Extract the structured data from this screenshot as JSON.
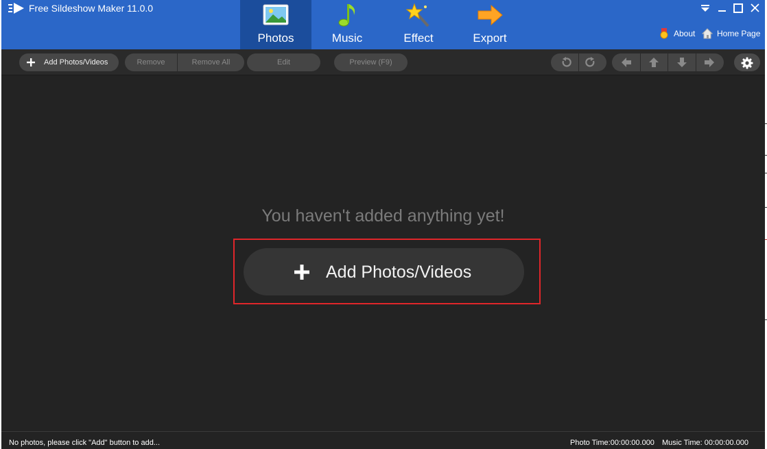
{
  "window": {
    "title": "Free Sildeshow Maker 11.0.0"
  },
  "tabs": [
    {
      "label": "Photos",
      "icon": "photo-icon",
      "active": true
    },
    {
      "label": "Music",
      "icon": "music-note-icon",
      "active": false
    },
    {
      "label": "Effect",
      "icon": "magic-wand-icon",
      "active": false
    },
    {
      "label": "Export",
      "icon": "arrow-right-icon",
      "active": false
    }
  ],
  "top_links": {
    "about": "About",
    "home": "Home Page"
  },
  "toolbar": {
    "add_label": "Add Photos/Videos",
    "remove_label": "Remove",
    "remove_all_label": "Remove All",
    "edit_label": "Edit",
    "preview_label": "Preview (F9)"
  },
  "main": {
    "empty_message": "You haven't added anything yet!",
    "add_button_label": "Add Photos/Videos"
  },
  "status": {
    "left_text": "No photos, please click \"Add\" button to add...",
    "photo_time": "Photo Time:00:00:00.000",
    "music_time": "Music Time:  00:00:00.000"
  },
  "colors": {
    "header_blue": "#2b67c8",
    "active_tab": "#1b4d9c",
    "background": "#232323",
    "highlight": "#e0262a"
  }
}
